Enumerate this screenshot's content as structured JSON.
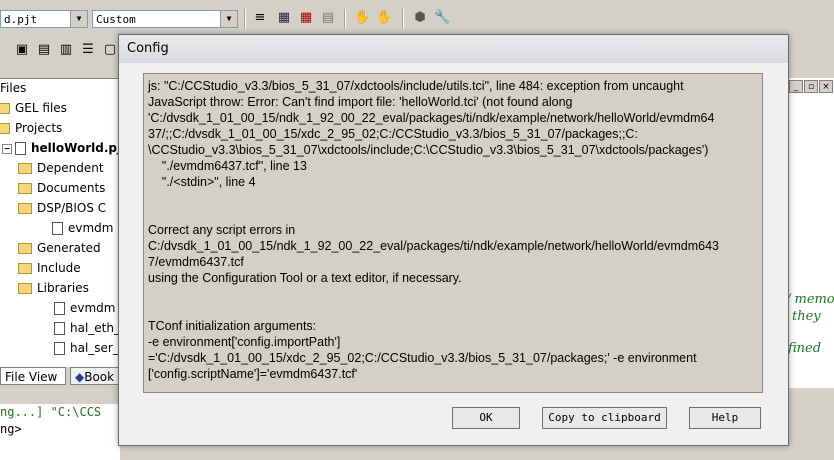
{
  "ide": {
    "project_combo": "d.pjt",
    "config_combo": "Custom",
    "tree": {
      "files": "Files",
      "gel_files": "GEL files",
      "projects": "Projects",
      "project_name": "helloWorld.pjt",
      "dependent": "Dependent",
      "documents": "Documents",
      "dsp_bios": "DSP/BIOS C",
      "tcf_file": "evmdm",
      "generated": "Generated",
      "include": "Include",
      "libraries": "Libraries",
      "lib1": "evmdm",
      "lib2": "hal_eth_",
      "lib3": "hal_ser_"
    },
    "tabs": {
      "file_view": "File View",
      "book": "Book"
    },
    "console": {
      "line1": "ng...] \"C:\\CCS",
      "line2": "ng>"
    },
    "right_code": {
      "line1": "/ memo",
      "line2": "they ",
      "line3": "fined "
    }
  },
  "dialog": {
    "title": "Config",
    "message_lines": [
      "js: \"C:/CCStudio_v3.3/bios_5_31_07/xdctools/include/utils.tci\", line 484: exception from uncaught",
      "JavaScript throw: Error: Can't find import file: 'helloWorld.tci' (not found along",
      "'C:/dvsdk_1_01_00_15/ndk_1_92_00_22_eval/packages/ti/ndk/example/network/helloWorld/evmdm64",
      "37/;;C:/dvsdk_1_01_00_15/xdc_2_95_02;C:/CCStudio_v3.3/bios_5_31_07/packages;;C:",
      "\\CCStudio_v3.3\\bios_5_31_07\\xdctools/include;C:\\CCStudio_v3.3\\bios_5_31_07\\xdctools/packages')",
      "    \"./evmdm6437.tcf\", line 13",
      "    \"./<stdin>\", line 4",
      "",
      "",
      "Correct any script errors in",
      "C:/dvsdk_1_01_00_15/ndk_1_92_00_22_eval/packages/ti/ndk/example/network/helloWorld/evmdm643",
      "7/evmdm6437.tcf",
      "using the Configuration Tool or a text editor, if necessary.",
      "",
      "",
      "TConf initialization arguments:",
      "-e environment['config.importPath']",
      "='C:/dvsdk_1_01_00_15/xdc_2_95_02;C:/CCStudio_v3.3/bios_5_31_07/packages;' -e environment",
      "['config.scriptName']='evmdm6437.tcf'"
    ],
    "buttons": {
      "ok": "OK",
      "copy": "Copy to clipboard",
      "help": "Help"
    }
  }
}
